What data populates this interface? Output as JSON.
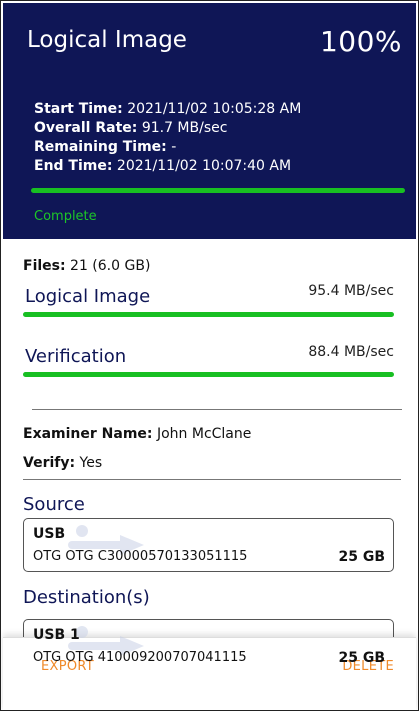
{
  "header": {
    "title": "Logical Image",
    "percent": "100%",
    "progress_fraction": 1.0,
    "start_time_label": "Start Time:",
    "start_time": "2021/11/02 10:05:28 AM",
    "overall_rate_label": "Overall Rate:",
    "overall_rate": "91.7 MB/sec",
    "remaining_time_label": "Remaining Time:",
    "remaining_time": "-",
    "end_time_label": "End Time:",
    "end_time": "2021/11/02 10:07:40 AM",
    "status": "Complete"
  },
  "files": {
    "label": "Files:",
    "value": "21 (6.0 GB)"
  },
  "tasks": [
    {
      "label": "Logical Image",
      "rate": "95.4 MB/sec",
      "progress_fraction": 1.0
    },
    {
      "label": "Verification",
      "rate": "88.4 MB/sec",
      "progress_fraction": 1.0
    }
  ],
  "examiner": {
    "label": "Examiner Name:",
    "value": "John McClane"
  },
  "verify": {
    "label": "Verify:",
    "value": "Yes"
  },
  "source": {
    "heading": "Source",
    "device": "USB",
    "description": "OTG OTG C30000570133051115",
    "size": "25 GB"
  },
  "destinations": {
    "heading": "Destination(s)",
    "device": "USB 1",
    "description": "OTG OTG 410009200707041115",
    "size": "25 GB"
  },
  "footer": {
    "export_label": "EXPORT",
    "delete_label": "DELETE"
  },
  "colors": {
    "header_bg": "#0f1656",
    "progress": "#18bf22",
    "accent": "#f08a2a",
    "heading": "#0f1656"
  }
}
